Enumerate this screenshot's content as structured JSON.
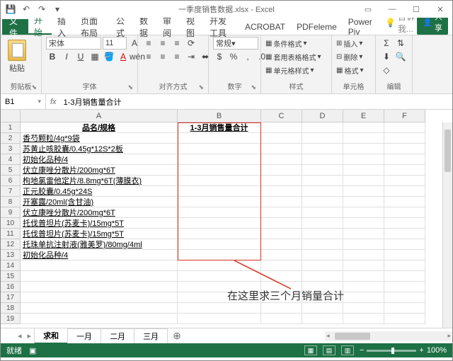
{
  "title": "一季度销售数据.xlsx - Excel",
  "tabs": {
    "file": "文件",
    "home": "开始",
    "insert": "插入",
    "layout": "页面布局",
    "formulas": "公式",
    "data": "数据",
    "review": "审阅",
    "view": "视图",
    "dev": "开发工具",
    "acrobat": "ACROBAT",
    "pdf": "PDFeleme",
    "power": "Power Piv"
  },
  "tellme": "告诉我...",
  "share": "共享",
  "ribbon": {
    "clipboard": {
      "label": "剪贴板",
      "paste": "粘贴"
    },
    "font": {
      "label": "字体",
      "name": "宋体",
      "size": "11"
    },
    "align": {
      "label": "对齐方式"
    },
    "number": {
      "label": "数字",
      "format": "常规"
    },
    "styles": {
      "label": "样式",
      "cond": "条件格式",
      "table": "套用表格格式",
      "cell": "单元格样式"
    },
    "cells": {
      "label": "单元格",
      "insert": "插入",
      "delete": "删除",
      "format": "格式"
    },
    "editing": {
      "label": "编辑"
    }
  },
  "namebox": "B1",
  "formula": "1-3月销售量合计",
  "cols": [
    "A",
    "B",
    "C",
    "D",
    "E",
    "F"
  ],
  "headers": {
    "a": "品名/规格",
    "b": "1-3月销售量合计"
  },
  "rows": [
    "香芍颗粒/4g*9袋",
    "苏黄止咳胶囊/0.45g*12S*2板",
    "初始化品种/4",
    "伏立康唑分散片/200mg*6T",
    "枸地氯雷他定片/8.8mg*6T(薄膜衣)",
    "正元胶囊/0.45g*24S",
    "开塞露/20ml(含甘油)",
    "伏立康唑分散片/200mg*6T",
    "托伐普坦片(苏麦卡)/15mg*5T",
    "托伐普坦片(苏麦卡)/15mg*5T",
    "托珠单抗注射液(雅美罗)/80mg/4ml",
    "初始化品种/4"
  ],
  "callout": "在这里求三个月销量合计",
  "sheets": {
    "s1": "求和",
    "s2": "一月",
    "s3": "二月",
    "s4": "三月"
  },
  "status": "就绪",
  "zoom": "100%"
}
